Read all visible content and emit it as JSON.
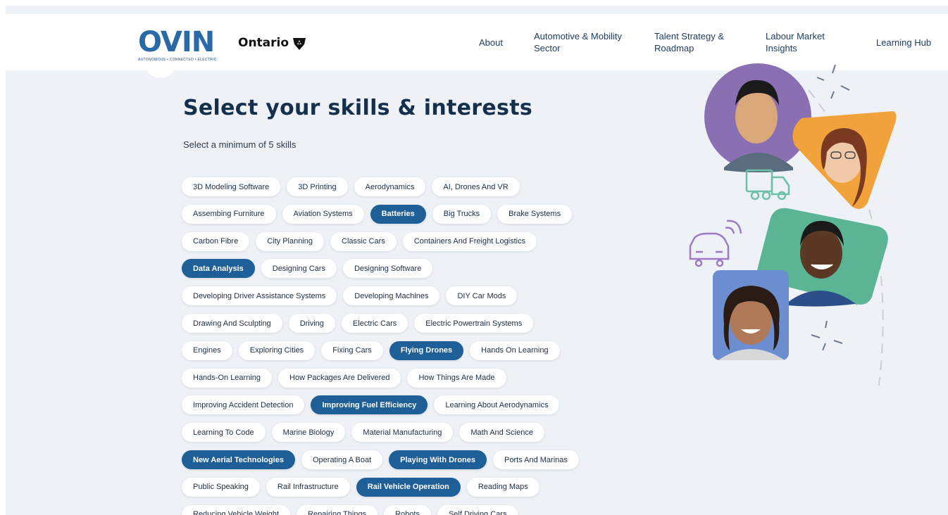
{
  "header": {
    "logo_text": "OVIN",
    "logo_tagline": "AUTONOMOUS • CONNECTED • ELECTRIC",
    "ontario_label": "Ontario",
    "nav": [
      {
        "label": "About"
      },
      {
        "label": "Automotive & Mobility Sector"
      },
      {
        "label": "Talent Strategy & Roadmap"
      },
      {
        "label": "Labour Market Insights"
      },
      {
        "label": "Learning Hub"
      }
    ]
  },
  "main": {
    "title": "Select your skills & interests",
    "subtitle": "Select a minimum of 5 skills",
    "chip_rows": [
      [
        {
          "label": "3D Modeling Software",
          "selected": false
        },
        {
          "label": "3D Printing",
          "selected": false
        },
        {
          "label": "Aerodynamics",
          "selected": false
        },
        {
          "label": "AI, Drones And VR",
          "selected": false
        }
      ],
      [
        {
          "label": "Assembing Furniture",
          "selected": false
        },
        {
          "label": "Aviation Systems",
          "selected": false
        },
        {
          "label": "Batteries",
          "selected": true
        },
        {
          "label": "Big Trucks",
          "selected": false
        },
        {
          "label": "Brake Systems",
          "selected": false
        }
      ],
      [
        {
          "label": "Carbon Fibre",
          "selected": false
        },
        {
          "label": "City Planning",
          "selected": false
        },
        {
          "label": "Classic Cars",
          "selected": false
        },
        {
          "label": "Containers And Freight Logistics",
          "selected": false
        }
      ],
      [
        {
          "label": "Data Analysis",
          "selected": true
        },
        {
          "label": "Designing Cars",
          "selected": false
        },
        {
          "label": "Designing Software",
          "selected": false
        }
      ],
      [
        {
          "label": "Developing Driver Assistance Systems",
          "selected": false
        },
        {
          "label": "Developing Machines",
          "selected": false
        },
        {
          "label": "DIY Car Mods",
          "selected": false
        }
      ],
      [
        {
          "label": "Drawing And Sculpting",
          "selected": false
        },
        {
          "label": "Driving",
          "selected": false
        },
        {
          "label": "Electric Cars",
          "selected": false
        },
        {
          "label": "Electric Powertrain Systems",
          "selected": false
        }
      ],
      [
        {
          "label": "Engines",
          "selected": false
        },
        {
          "label": "Exploring Cities",
          "selected": false
        },
        {
          "label": "Fixing Cars",
          "selected": false
        },
        {
          "label": "Flying Drones",
          "selected": true
        },
        {
          "label": "Hands On Learning",
          "selected": false
        }
      ],
      [
        {
          "label": "Hands-On Learning",
          "selected": false
        },
        {
          "label": "How Packages Are Delivered",
          "selected": false
        },
        {
          "label": "How Things Are Made",
          "selected": false
        }
      ],
      [
        {
          "label": "Improving Accident Detection",
          "selected": false
        },
        {
          "label": "Improving Fuel Efficiency",
          "selected": true
        },
        {
          "label": "Learning About Aerodynamics",
          "selected": false
        }
      ],
      [
        {
          "label": "Learning To Code",
          "selected": false
        },
        {
          "label": "Marine Biology",
          "selected": false
        },
        {
          "label": "Material Manufacturing",
          "selected": false
        },
        {
          "label": "Math And Science",
          "selected": false
        }
      ],
      [
        {
          "label": "New Aerial Technologies",
          "selected": true
        },
        {
          "label": "Operating A Boat",
          "selected": false
        },
        {
          "label": "Playing With Drones",
          "selected": true
        },
        {
          "label": "Ports And Marinas",
          "selected": false
        }
      ],
      [
        {
          "label": "Public Speaking",
          "selected": false
        },
        {
          "label": "Rail Infrastructure",
          "selected": false
        },
        {
          "label": "Rail Vehicle Operation",
          "selected": true
        },
        {
          "label": "Reading Maps",
          "selected": false
        }
      ],
      [
        {
          "label": "Reducing Vehicle Weight",
          "selected": false
        },
        {
          "label": "Repairing Things",
          "selected": false
        },
        {
          "label": "Robots",
          "selected": false
        },
        {
          "label": "Self Driving Cars",
          "selected": false
        }
      ]
    ]
  },
  "colors": {
    "selected_chip": "#1f5f97",
    "heading": "#14304d",
    "background": "#eef1f5",
    "brand_blue": "#2a6aa6"
  },
  "illustration": {
    "icons": [
      "truck-icon",
      "connected-car-icon"
    ],
    "photos": [
      "person-photo-1",
      "person-photo-2",
      "person-photo-3",
      "person-photo-4"
    ]
  }
}
